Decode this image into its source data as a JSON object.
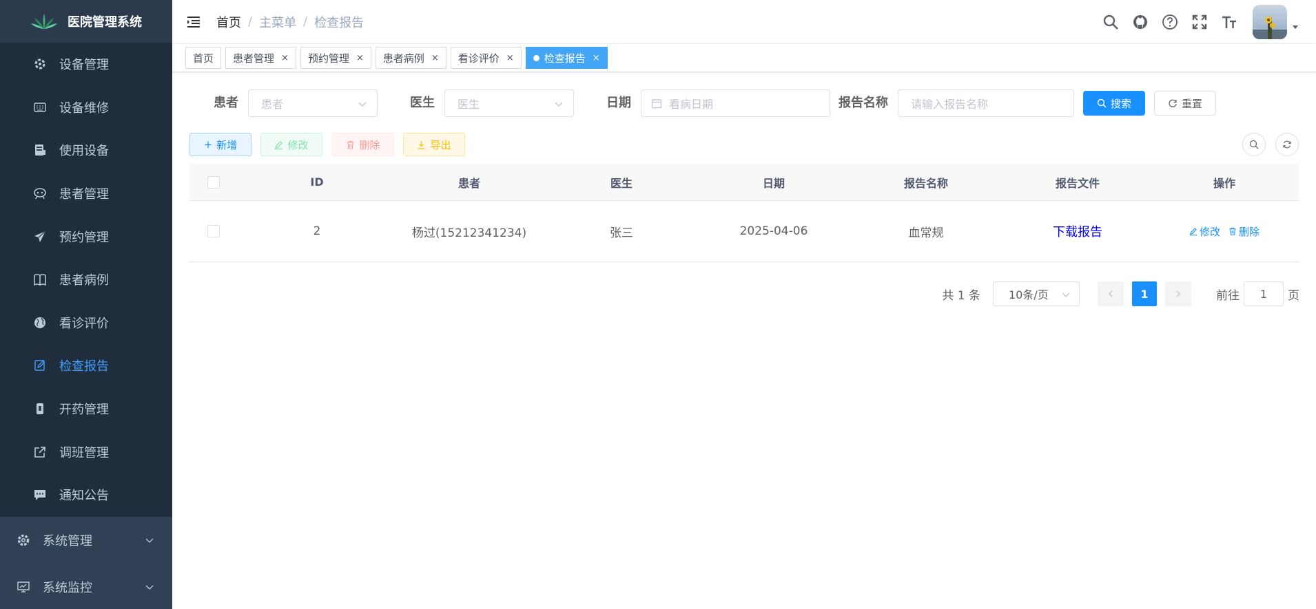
{
  "app": {
    "title": "医院管理系统"
  },
  "sidebar": {
    "items": [
      {
        "label": "设备管理",
        "icon": "settings-gear-icon"
      },
      {
        "label": "设备维修",
        "icon": "keyboard-icon"
      },
      {
        "label": "使用设备",
        "icon": "server-icon"
      },
      {
        "label": "患者管理",
        "icon": "people-icon"
      },
      {
        "label": "预约管理",
        "icon": "paper-plane-icon"
      },
      {
        "label": "患者病例",
        "icon": "book-icon"
      },
      {
        "label": "看诊评价",
        "icon": "globe-icon"
      },
      {
        "label": "检查报告",
        "icon": "edit-document-icon",
        "active": true
      },
      {
        "label": "开药管理",
        "icon": "pill-icon"
      },
      {
        "label": "调班管理",
        "icon": "external-link-icon"
      },
      {
        "label": "通知公告",
        "icon": "message-icon"
      }
    ],
    "groups": [
      {
        "label": "系统管理",
        "icon": "system-settings-icon"
      },
      {
        "label": "系统监控",
        "icon": "monitor-icon"
      }
    ]
  },
  "breadcrumb": [
    "首页",
    "主菜单",
    "检查报告"
  ],
  "tags": [
    {
      "label": "首页",
      "closable": false
    },
    {
      "label": "患者管理",
      "closable": true
    },
    {
      "label": "预约管理",
      "closable": true
    },
    {
      "label": "患者病例",
      "closable": true
    },
    {
      "label": "看诊评价",
      "closable": true
    },
    {
      "label": "检查报告",
      "closable": true,
      "active": true
    }
  ],
  "search": {
    "patient_label": "患者",
    "patient_placeholder": "患者",
    "doctor_label": "医生",
    "doctor_placeholder": "医生",
    "date_label": "日期",
    "date_placeholder": "看病日期",
    "report_label": "报告名称",
    "report_placeholder": "请输入报告名称",
    "search_btn": "搜索",
    "reset_btn": "重置"
  },
  "toolbar": {
    "add": "新增",
    "edit": "修改",
    "delete": "删除",
    "export": "导出"
  },
  "table": {
    "headers": [
      "ID",
      "患者",
      "医生",
      "日期",
      "报告名称",
      "报告文件",
      "操作"
    ],
    "rows": [
      {
        "id": "2",
        "patient": "杨过(15212341234)",
        "doctor": "张三",
        "date": "2025-04-06",
        "report_name": "血常规",
        "file_link": "下载报告",
        "op_edit": "修改",
        "op_delete": "删除"
      }
    ]
  },
  "pagination": {
    "total": "共 1 条",
    "page_size": "10条/页",
    "current": "1",
    "goto_prefix": "前往",
    "goto_value": "1",
    "goto_suffix": "页"
  },
  "colors": {
    "sidebar_bg": "#304156",
    "accent": "#1890ff",
    "active_menu": "#409eff"
  }
}
